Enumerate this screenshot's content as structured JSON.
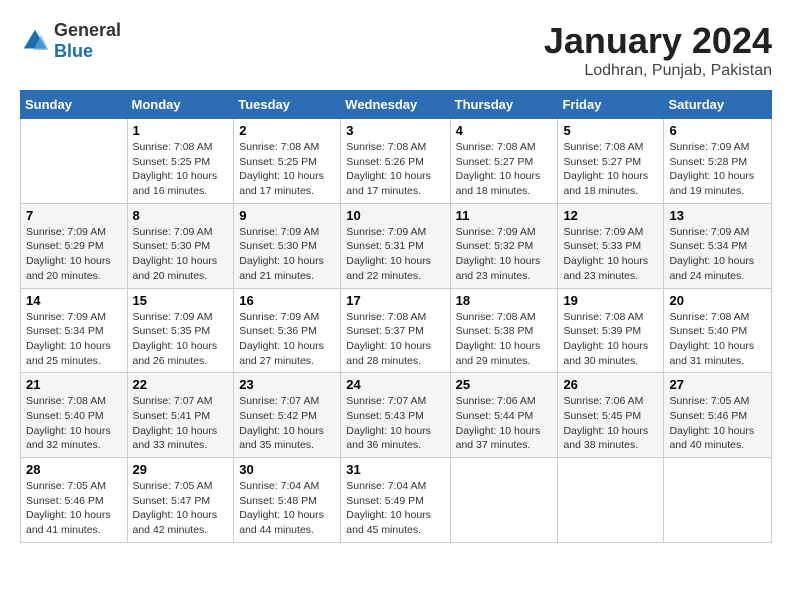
{
  "logo": {
    "general": "General",
    "blue": "Blue"
  },
  "title": "January 2024",
  "subtitle": "Lodhran, Punjab, Pakistan",
  "header_days": [
    "Sunday",
    "Monday",
    "Tuesday",
    "Wednesday",
    "Thursday",
    "Friday",
    "Saturday"
  ],
  "weeks": [
    [
      {
        "day": "",
        "info": ""
      },
      {
        "day": "1",
        "info": "Sunrise: 7:08 AM\nSunset: 5:25 PM\nDaylight: 10 hours\nand 16 minutes."
      },
      {
        "day": "2",
        "info": "Sunrise: 7:08 AM\nSunset: 5:25 PM\nDaylight: 10 hours\nand 17 minutes."
      },
      {
        "day": "3",
        "info": "Sunrise: 7:08 AM\nSunset: 5:26 PM\nDaylight: 10 hours\nand 17 minutes."
      },
      {
        "day": "4",
        "info": "Sunrise: 7:08 AM\nSunset: 5:27 PM\nDaylight: 10 hours\nand 18 minutes."
      },
      {
        "day": "5",
        "info": "Sunrise: 7:08 AM\nSunset: 5:27 PM\nDaylight: 10 hours\nand 18 minutes."
      },
      {
        "day": "6",
        "info": "Sunrise: 7:09 AM\nSunset: 5:28 PM\nDaylight: 10 hours\nand 19 minutes."
      }
    ],
    [
      {
        "day": "7",
        "info": "Sunrise: 7:09 AM\nSunset: 5:29 PM\nDaylight: 10 hours\nand 20 minutes."
      },
      {
        "day": "8",
        "info": "Sunrise: 7:09 AM\nSunset: 5:30 PM\nDaylight: 10 hours\nand 20 minutes."
      },
      {
        "day": "9",
        "info": "Sunrise: 7:09 AM\nSunset: 5:30 PM\nDaylight: 10 hours\nand 21 minutes."
      },
      {
        "day": "10",
        "info": "Sunrise: 7:09 AM\nSunset: 5:31 PM\nDaylight: 10 hours\nand 22 minutes."
      },
      {
        "day": "11",
        "info": "Sunrise: 7:09 AM\nSunset: 5:32 PM\nDaylight: 10 hours\nand 23 minutes."
      },
      {
        "day": "12",
        "info": "Sunrise: 7:09 AM\nSunset: 5:33 PM\nDaylight: 10 hours\nand 23 minutes."
      },
      {
        "day": "13",
        "info": "Sunrise: 7:09 AM\nSunset: 5:34 PM\nDaylight: 10 hours\nand 24 minutes."
      }
    ],
    [
      {
        "day": "14",
        "info": "Sunrise: 7:09 AM\nSunset: 5:34 PM\nDaylight: 10 hours\nand 25 minutes."
      },
      {
        "day": "15",
        "info": "Sunrise: 7:09 AM\nSunset: 5:35 PM\nDaylight: 10 hours\nand 26 minutes."
      },
      {
        "day": "16",
        "info": "Sunrise: 7:09 AM\nSunset: 5:36 PM\nDaylight: 10 hours\nand 27 minutes."
      },
      {
        "day": "17",
        "info": "Sunrise: 7:08 AM\nSunset: 5:37 PM\nDaylight: 10 hours\nand 28 minutes."
      },
      {
        "day": "18",
        "info": "Sunrise: 7:08 AM\nSunset: 5:38 PM\nDaylight: 10 hours\nand 29 minutes."
      },
      {
        "day": "19",
        "info": "Sunrise: 7:08 AM\nSunset: 5:39 PM\nDaylight: 10 hours\nand 30 minutes."
      },
      {
        "day": "20",
        "info": "Sunrise: 7:08 AM\nSunset: 5:40 PM\nDaylight: 10 hours\nand 31 minutes."
      }
    ],
    [
      {
        "day": "21",
        "info": "Sunrise: 7:08 AM\nSunset: 5:40 PM\nDaylight: 10 hours\nand 32 minutes."
      },
      {
        "day": "22",
        "info": "Sunrise: 7:07 AM\nSunset: 5:41 PM\nDaylight: 10 hours\nand 33 minutes."
      },
      {
        "day": "23",
        "info": "Sunrise: 7:07 AM\nSunset: 5:42 PM\nDaylight: 10 hours\nand 35 minutes."
      },
      {
        "day": "24",
        "info": "Sunrise: 7:07 AM\nSunset: 5:43 PM\nDaylight: 10 hours\nand 36 minutes."
      },
      {
        "day": "25",
        "info": "Sunrise: 7:06 AM\nSunset: 5:44 PM\nDaylight: 10 hours\nand 37 minutes."
      },
      {
        "day": "26",
        "info": "Sunrise: 7:06 AM\nSunset: 5:45 PM\nDaylight: 10 hours\nand 38 minutes."
      },
      {
        "day": "27",
        "info": "Sunrise: 7:05 AM\nSunset: 5:46 PM\nDaylight: 10 hours\nand 40 minutes."
      }
    ],
    [
      {
        "day": "28",
        "info": "Sunrise: 7:05 AM\nSunset: 5:46 PM\nDaylight: 10 hours\nand 41 minutes."
      },
      {
        "day": "29",
        "info": "Sunrise: 7:05 AM\nSunset: 5:47 PM\nDaylight: 10 hours\nand 42 minutes."
      },
      {
        "day": "30",
        "info": "Sunrise: 7:04 AM\nSunset: 5:48 PM\nDaylight: 10 hours\nand 44 minutes."
      },
      {
        "day": "31",
        "info": "Sunrise: 7:04 AM\nSunset: 5:49 PM\nDaylight: 10 hours\nand 45 minutes."
      },
      {
        "day": "",
        "info": ""
      },
      {
        "day": "",
        "info": ""
      },
      {
        "day": "",
        "info": ""
      }
    ]
  ]
}
